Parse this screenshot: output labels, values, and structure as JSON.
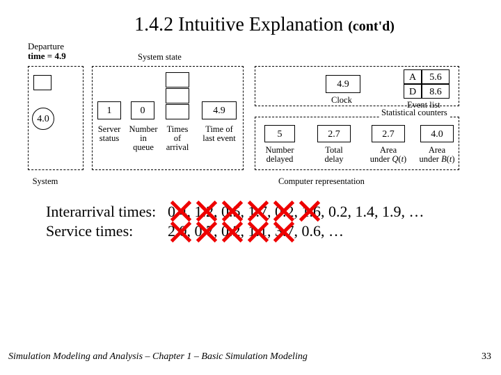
{
  "title": {
    "main": "1.4.2  Intuitive Explanation",
    "contd": "(cont'd)"
  },
  "diagram": {
    "departure": {
      "label1": "Departure",
      "label2": "time = 4.9"
    },
    "customer_depart": "4.0",
    "system_state_label": "System state",
    "server_status": {
      "val": "1",
      "label": "Server\nstatus"
    },
    "num_in_queue": {
      "val": "0",
      "label": "Number\nin\nqueue"
    },
    "times_arrival": {
      "label": "Times\nof\narrival"
    },
    "time_last_event": {
      "val": "4.9",
      "label": "Time of\nlast event"
    },
    "clock": {
      "val": "4.9",
      "label": "Clock"
    },
    "event_list": {
      "r1c1": "A",
      "r1c2": "5.6",
      "r2c1": "D",
      "r2c2": "8.6",
      "label": "Event list"
    },
    "stat_counters_label": "Statistical counters",
    "num_delayed": {
      "val": "5",
      "label": "Number\ndelayed"
    },
    "total_delay": {
      "val": "2.7",
      "label": "Total\ndelay"
    },
    "area_q": {
      "val": "2.7",
      "label1": "Area",
      "label2": "under Q(t)"
    },
    "area_b": {
      "val": "4.0",
      "label1": "Area",
      "label2": "under B(t)"
    },
    "system_label": "System",
    "comp_rep_label": "Computer representation"
  },
  "times": {
    "label1": "Interarrival times:",
    "label2": "Service times:",
    "row1": "0.4, 1.2, 0.5, 1.7, 0.2, 1.6, 0.2, 1.4, 1.9, …",
    "row2": "2.0, 0.7, 0.2, 1.1, 3.7, 0.6, …"
  },
  "footer": {
    "text": "Simulation Modeling and Analysis – Chapter 1 –  Basic Simulation Modeling",
    "page": "33"
  }
}
